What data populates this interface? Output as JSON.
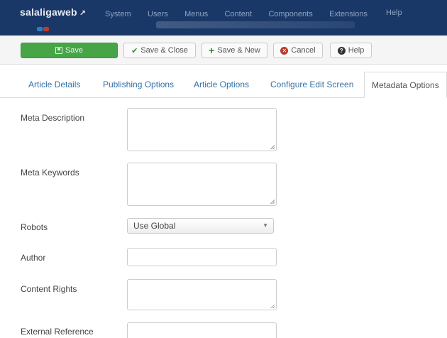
{
  "navbar": {
    "brand": "salaligaweb",
    "brand_icon": "external-link-icon",
    "items": [
      "System",
      "Users",
      "Menus",
      "Content",
      "Components",
      "Extensions",
      "Help"
    ],
    "colors": {
      "background": "#1a3867",
      "text": "#8ea3c2"
    }
  },
  "toolbar": {
    "save_label": "Save",
    "save_close_label": "Save & Close",
    "save_new_label": "Save & New",
    "cancel_label": "Cancel",
    "help_label": "Help",
    "colors": {
      "save": "#46a546"
    }
  },
  "tabs": [
    {
      "label": "Article Details",
      "active": false
    },
    {
      "label": "Publishing Options",
      "active": false
    },
    {
      "label": "Article Options",
      "active": false
    },
    {
      "label": "Configure Edit Screen",
      "active": false
    },
    {
      "label": "Metadata Options",
      "active": true
    }
  ],
  "form": {
    "meta_description_label": "Meta Description",
    "meta_description_value": "",
    "meta_keywords_label": "Meta Keywords",
    "meta_keywords_value": "",
    "robots_label": "Robots",
    "robots_value": "Use Global",
    "author_label": "Author",
    "author_value": "",
    "content_rights_label": "Content Rights",
    "content_rights_value": "",
    "external_reference_label": "External Reference",
    "external_reference_value": ""
  }
}
